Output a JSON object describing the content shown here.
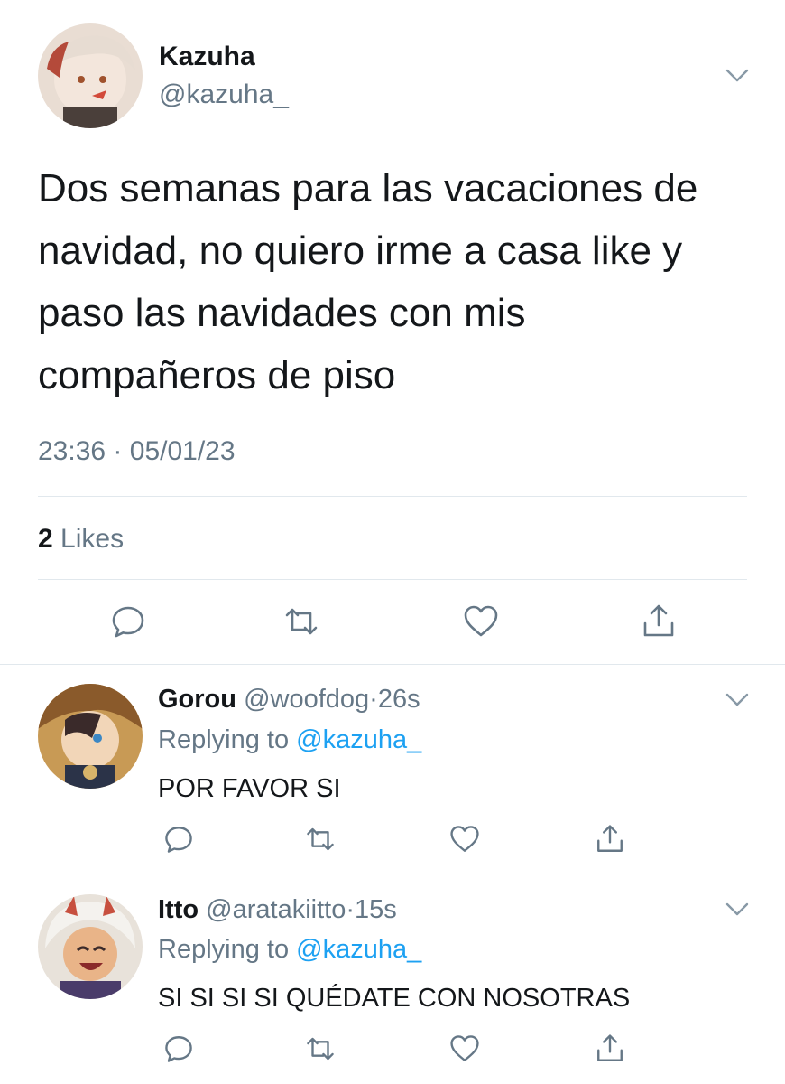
{
  "tweet": {
    "author_name": "Kazuha",
    "author_handle": "@kazuha_",
    "text": "Dos semanas para las vacaciones de navidad, no quiero irme a casa like y paso las navidades con mis compañeros de piso",
    "time": "23:36",
    "separator": "·",
    "date": "05/01/23",
    "likes_count": "2",
    "likes_label": "Likes"
  },
  "replies": [
    {
      "name": "Gorou",
      "handle": "@woofdog",
      "separator": "·",
      "age": "26s",
      "replying_prefix": "Replying to",
      "replying_mention": "@kazuha_",
      "text": "POR FAVOR SI"
    },
    {
      "name": "Itto",
      "handle": "@aratakiitto",
      "separator": "·",
      "age": "15s",
      "replying_prefix": "Replying to",
      "replying_mention": "@kazuha_",
      "text": "SI SI SI SI QUÉDATE CON NOSOTRAS"
    }
  ],
  "icons": {
    "options": "chevron-down-icon",
    "reply": "speech-bubble-icon",
    "retweet": "retweet-arrows-icon",
    "like": "heart-icon",
    "share": "share-upload-icon"
  },
  "colors": {
    "text": "#14171a",
    "secondary": "#657786",
    "link": "#1da1f2",
    "divider": "#e1e8ed"
  }
}
